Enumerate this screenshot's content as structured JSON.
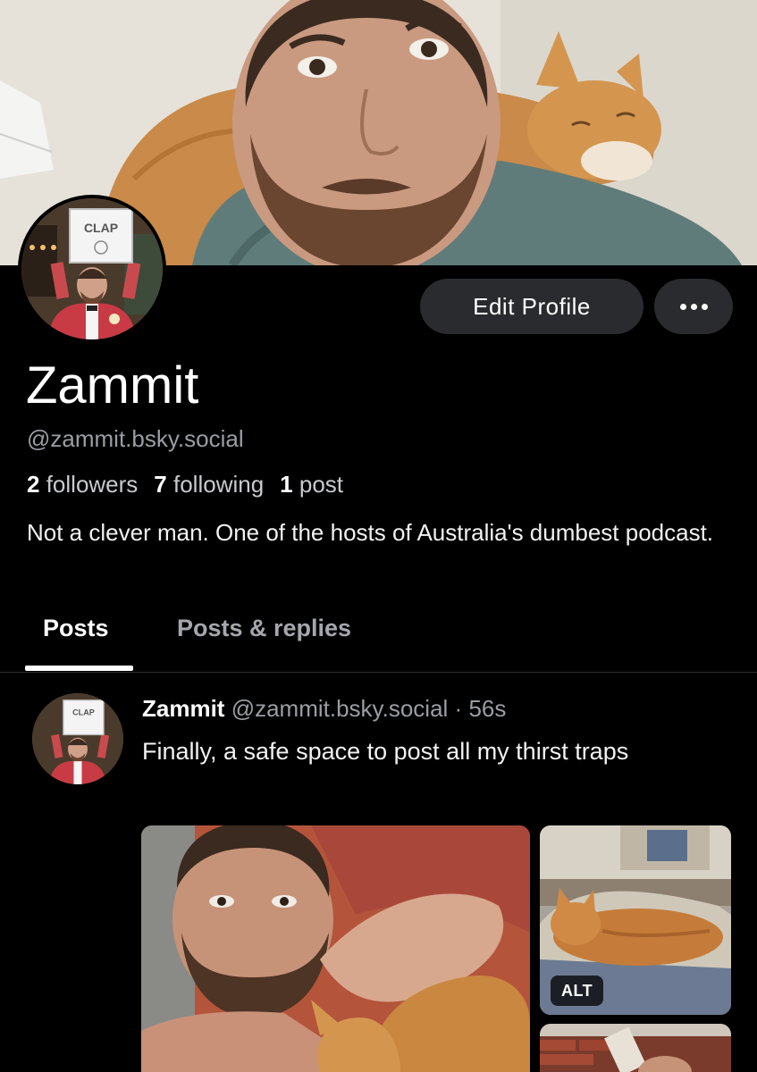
{
  "profile": {
    "display_name": "Zammit",
    "handle": "@zammit.bsky.social",
    "followers_count": "2",
    "followers_label": "followers",
    "following_count": "7",
    "following_label": "following",
    "posts_count": "1",
    "posts_label": "post",
    "bio": "Not a clever man. One of the hosts of Australia's dumbest podcast.",
    "avatar_sign_text": "CLAP"
  },
  "actions": {
    "edit_profile_label": "Edit Profile",
    "more_icon": "ellipsis-icon"
  },
  "tabs": [
    {
      "label": "Posts",
      "active": true
    },
    {
      "label": "Posts & replies",
      "active": false
    }
  ],
  "post": {
    "author_name": "Zammit",
    "author_handle": "@zammit.bsky.social",
    "separator": " · ",
    "time_ago": "56s",
    "text": "Finally, a safe space to post all my thirst traps",
    "alt_badge": "ALT"
  },
  "colors": {
    "background": "#000000",
    "button_bg": "#2a2b2f",
    "muted_text": "#9a9da3"
  }
}
